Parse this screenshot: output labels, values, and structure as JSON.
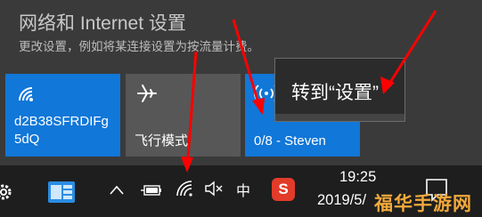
{
  "network_flyout": {
    "title": "网络和 Internet 设置",
    "description": "更改设置，例如将某连接设置为按流量计费。",
    "tiles": [
      {
        "label_line1": "d2B38SFRDIFg",
        "label_line2": "5dQ",
        "icon": "wifi-icon",
        "state": "on"
      },
      {
        "label_line1": "飞行模式",
        "icon": "airplane-icon",
        "state": "off"
      },
      {
        "label_line1": "0/8 - Steven",
        "icon": "mobile-hotspot-icon",
        "state": "on"
      }
    ],
    "tooltip": "转到“设置”"
  },
  "taskbar": {
    "ime_label": "中",
    "sogou_label": "S",
    "time": "19:25",
    "date": "2019/5/",
    "icons": [
      "gear-icon",
      "app-icon",
      "chevron-up-icon",
      "battery-icon",
      "wifi-icon",
      "volume-muted-icon",
      "sogou-icon",
      "notification-icon"
    ]
  },
  "watermark": {
    "text": "福华手游网"
  },
  "colors": {
    "accent": "#1177d8",
    "tile_off": "#575757",
    "arrow": "#ff0000",
    "flyout_bg": "#3a3a3a",
    "taskbar_bg": "#1e1e1e",
    "watermark": "#f2a93b"
  }
}
